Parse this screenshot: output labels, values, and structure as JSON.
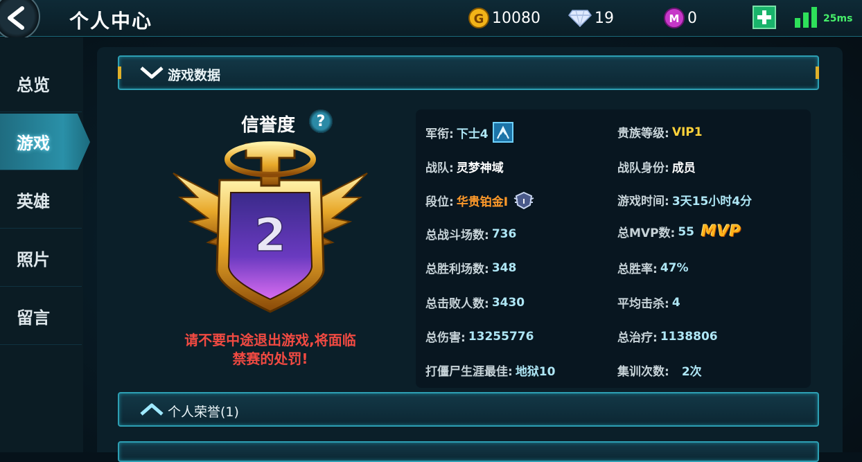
{
  "header": {
    "title": "个人中心",
    "gold": "10080",
    "diamond": "19",
    "gem": "0",
    "ping": "25ms"
  },
  "sidebar": {
    "items": [
      {
        "label": "总览"
      },
      {
        "label": "游戏"
      },
      {
        "label": "英雄"
      },
      {
        "label": "照片"
      },
      {
        "label": "留言"
      }
    ],
    "active": "游戏"
  },
  "sections": {
    "game_data": "游戏数据",
    "honors": "个人荣誉(1)"
  },
  "credit": {
    "title": "信誉度",
    "score": "2",
    "warning_line1": "请不要中途退出游戏,将面临",
    "warning_line2": "禁赛的处罚!"
  },
  "stats": {
    "rank_label": "军衔:",
    "rank_value": "下士4",
    "noble_label": "贵族等级:",
    "noble_value": "VIP1",
    "team_label": "战队:",
    "team_value": "灵梦神域",
    "team_role_label": "战队身份:",
    "team_role_value": "成员",
    "tier_label": "段位:",
    "tier_value": "华贵铂金I",
    "playtime_label": "游戏时间:",
    "playtime_value": "3天15小时4分",
    "battles_label": "总战斗场数:",
    "battles_value": "736",
    "mvp_label": "总MVP数:",
    "mvp_value": "55",
    "mvp_tag": "MVP",
    "wins_label": "总胜利场数:",
    "wins_value": "348",
    "winrate_label": "总胜率:",
    "winrate_value": "47%",
    "kills_label": "总击败人数:",
    "kills_value": "3430",
    "avg_kills_label": "平均击杀:",
    "avg_kills_value": "4",
    "damage_label": "总伤害:",
    "damage_value": "13255776",
    "heal_label": "总治疗:",
    "heal_value": "1138806",
    "zombie_label": "打僵尸生涯最佳:",
    "zombie_value": "地狱10",
    "training_label": "集训次数:",
    "training_value": "2次"
  },
  "colors": {
    "accent": "#2d9fb3",
    "gold_text": "#ffd23a",
    "warning": "#f14a42",
    "tier": "#ff9a2a",
    "ping": "#46f06a"
  }
}
